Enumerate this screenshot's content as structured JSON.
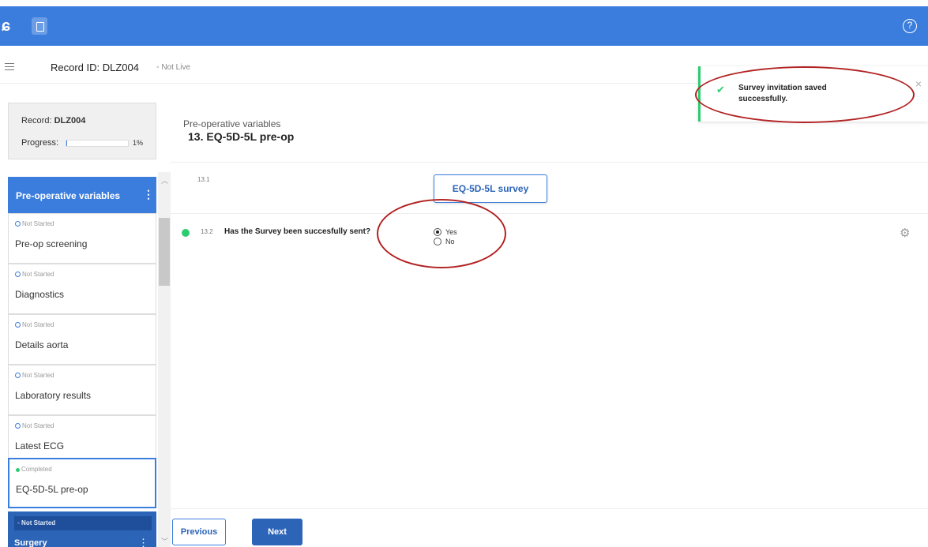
{
  "topbar": {
    "logo": "ɕ",
    "help": "?"
  },
  "header": {
    "record_id": "Record ID: DLZ004",
    "live_status": "◦ Not Live"
  },
  "toast": {
    "check": "✔",
    "message": "Survey invitation saved successfully.",
    "close": "×"
  },
  "record_card": {
    "record_label": "Record: ",
    "record_value": "DLZ004",
    "progress_label": "Progress:",
    "progress_fraction": 0.01,
    "progress_text": "1%"
  },
  "sidebar": {
    "section_title": "Pre-operative variables",
    "steps": [
      {
        "status": "Not Started",
        "label": "Pre-op screening"
      },
      {
        "status": "Not Started",
        "label": "Diagnostics"
      },
      {
        "status": "Not Started",
        "label": "Details aorta"
      },
      {
        "status": "Not Started",
        "label": "Laboratory results"
      },
      {
        "status": "Not Started",
        "label": "Latest ECG"
      },
      {
        "status": "Completed",
        "label": "EQ-5D-5L pre-op"
      }
    ],
    "next_section_status": "◦ Not Started",
    "next_section_label": "Surgery"
  },
  "form": {
    "section": "Pre-operative variables",
    "title": "13. EQ-5D-5L pre-op",
    "fields": [
      {
        "number": "13.1",
        "button_label": "EQ-5D-5L survey"
      },
      {
        "number": "13.2",
        "question": "Has the Survey been succesfully sent?",
        "options": [
          "Yes",
          "No"
        ],
        "selected": "Yes"
      }
    ]
  },
  "footer": {
    "previous_label": "Previous",
    "next_label": "Next"
  },
  "colors": {
    "brand": "#3b7ddd",
    "brand_dark": "#2c64b8",
    "success": "#2ecc71",
    "annotation": "#b22222"
  },
  "icons": [
    "logo-icon",
    "device-icon",
    "help-icon",
    "hamburger-icon",
    "check-icon",
    "close-icon",
    "kebab-menu-icon",
    "gear-icon",
    "status-dot-icon"
  ]
}
